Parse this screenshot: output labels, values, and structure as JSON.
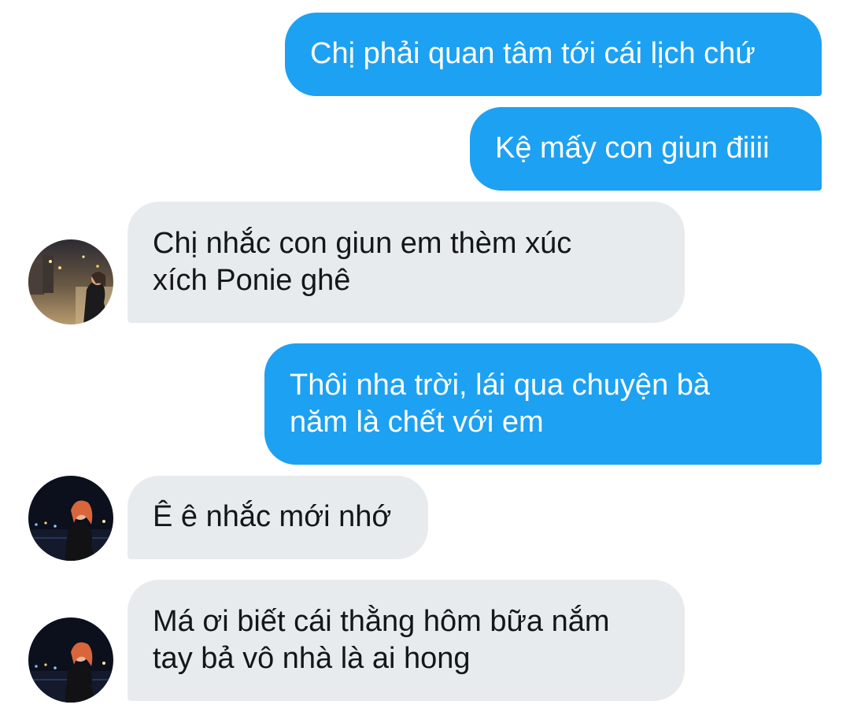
{
  "conversation": {
    "messages": [
      {
        "direction": "outgoing",
        "lines": [
          "Chị phải quan tâm tới cái lịch chứ"
        ]
      },
      {
        "direction": "outgoing",
        "lines": [
          "Kệ mấy con giun điiii"
        ]
      },
      {
        "direction": "incoming",
        "lines": [
          "Chị nhắc con giun em thèm xúc",
          "xích Ponie ghê"
        ],
        "avatar": "user-avatar-icon"
      },
      {
        "direction": "outgoing",
        "lines": [
          "Thôi nha trời, lái qua chuyện bà",
          "năm là chết với em"
        ]
      },
      {
        "direction": "incoming",
        "lines": [
          "Ê ê nhắc mới nhớ"
        ],
        "avatar": "user-avatar-icon"
      },
      {
        "direction": "incoming",
        "lines": [
          "Má ơi biết cái thằng hôm bữa nắm",
          "tay bả vô nhà là ai hong"
        ],
        "avatar": "user-avatar-icon"
      }
    ]
  },
  "colors": {
    "outgoing_bubble": "#1da1f2",
    "incoming_bubble": "#e8ebee",
    "outgoing_text": "#ffffff",
    "incoming_text": "#14171a"
  }
}
